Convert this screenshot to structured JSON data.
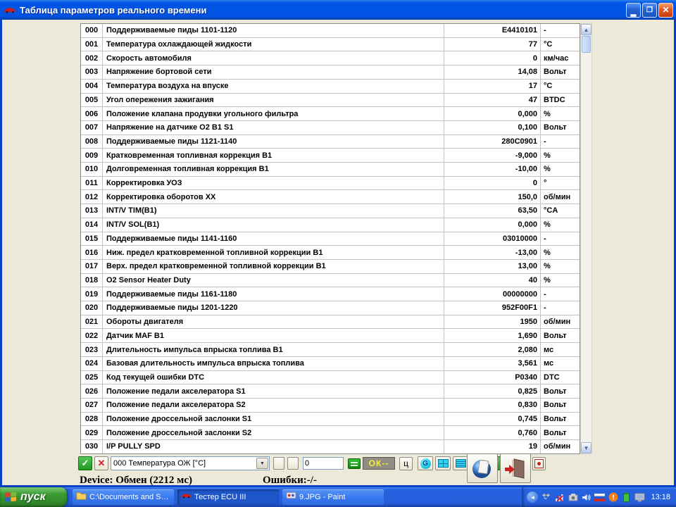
{
  "window": {
    "title": "Таблица параметров реального времени"
  },
  "icons": {
    "minimize": "▂",
    "restore": "❐",
    "close": "✕",
    "check": "✓",
    "cross": "✕",
    "arrow_up": "▲",
    "arrow_down": "▼",
    "chevron_left": "◄"
  },
  "table": {
    "rows": [
      {
        "id": "000",
        "name": "Поддерживаемые пиды 1101-1120",
        "value": "E4410101",
        "unit": "-"
      },
      {
        "id": "001",
        "name": "Температура охлаждающей жидкости",
        "value": "77",
        "unit": "°C"
      },
      {
        "id": "002",
        "name": "Скорость автомобиля",
        "value": "0",
        "unit": "км/час"
      },
      {
        "id": "003",
        "name": "Напряжение бортовой сети",
        "value": "14,08",
        "unit": "Вольт"
      },
      {
        "id": "004",
        "name": "Температура воздуха на впуске",
        "value": "17",
        "unit": "°C"
      },
      {
        "id": "005",
        "name": "Угол опережения зажигания",
        "value": "47",
        "unit": "BTDC"
      },
      {
        "id": "006",
        "name": "Положение клапана продувки угольного фильтра",
        "value": "0,000",
        "unit": "%"
      },
      {
        "id": "007",
        "name": "Напряжение на датчике O2 B1 S1",
        "value": "0,100",
        "unit": "Вольт"
      },
      {
        "id": "008",
        "name": "Поддерживаемые пиды 1121-1140",
        "value": "280C0901",
        "unit": "-"
      },
      {
        "id": "009",
        "name": "Кратковременная топливная коррекция B1",
        "value": "-9,000",
        "unit": "%"
      },
      {
        "id": "010",
        "name": "Долговременная топливная коррекция B1",
        "value": "-10,00",
        "unit": "%"
      },
      {
        "id": "011",
        "name": "Корректировка УОЗ",
        "value": "0",
        "unit": "°"
      },
      {
        "id": "012",
        "name": "Корректировка оборотов ХХ",
        "value": "150,0",
        "unit": "об/мин"
      },
      {
        "id": "013",
        "name": "INT/V TIM(B1)",
        "value": "63,50",
        "unit": "°CA"
      },
      {
        "id": "014",
        "name": "INT/V SOL(B1)",
        "value": "0,000",
        "unit": "%"
      },
      {
        "id": "015",
        "name": "Поддерживаемые пиды 1141-1160",
        "value": "03010000",
        "unit": "-"
      },
      {
        "id": "016",
        "name": "Ниж. предел кратковременной топливной коррекции B1",
        "value": "-13,00",
        "unit": "%"
      },
      {
        "id": "017",
        "name": "Верх. предел кратковременной топливной коррекции B1",
        "value": "13,00",
        "unit": "%"
      },
      {
        "id": "018",
        "name": "O2 Sensor Heater Duty",
        "value": "40",
        "unit": "%"
      },
      {
        "id": "019",
        "name": "Поддерживаемые пиды 1161-1180",
        "value": "00000000",
        "unit": "-"
      },
      {
        "id": "020",
        "name": "Поддерживаемые пиды 1201-1220",
        "value": "952F00F1",
        "unit": "-"
      },
      {
        "id": "021",
        "name": "Обороты двигателя",
        "value": "1950",
        "unit": "об/мин"
      },
      {
        "id": "022",
        "name": "Датчик MAF B1",
        "value": "1,690",
        "unit": "Вольт"
      },
      {
        "id": "023",
        "name": "Длительность импульса впрыска топлива B1",
        "value": "2,080",
        "unit": "мс"
      },
      {
        "id": "024",
        "name": "Базовая длительность импульса впрыска топлива",
        "value": "3,561",
        "unit": "мс"
      },
      {
        "id": "025",
        "name": "Код текущей ошибки DTC",
        "value": "P0340",
        "unit": "DTC"
      },
      {
        "id": "026",
        "name": "Положение педали акселератора S1",
        "value": "0,825",
        "unit": "Вольт"
      },
      {
        "id": "027",
        "name": "Положение педали акселератора S2",
        "value": "0,830",
        "unit": "Вольт"
      },
      {
        "id": "028",
        "name": "Положение дроссельной заслонки S1",
        "value": "0,745",
        "unit": "Вольт"
      },
      {
        "id": "029",
        "name": "Положение дроссельной заслонки S2",
        "value": "0,760",
        "unit": "Вольт"
      },
      {
        "id": "030",
        "name": "I/P PULLY SPD",
        "value": "19",
        "unit": "об/мин"
      }
    ]
  },
  "toolbar": {
    "combo_value": "000 Температура ОЖ [°C]",
    "input_value": "0",
    "ok_display": "ОК--",
    "c_button_label": "ц",
    "g_button_label": "G"
  },
  "status": {
    "device": "Device: Обмен (2212 мс)",
    "errors": "Ошибки:-/-"
  },
  "taskbar": {
    "start_label": "пуск",
    "clock": "13:18",
    "tasks": [
      {
        "label": "C:\\Documents and Se...",
        "icon": "folder",
        "active": false
      },
      {
        "label": "Тестер ECU III",
        "icon": "car",
        "active": true
      },
      {
        "label": "9.JPG - Paint",
        "icon": "paint",
        "active": false
      }
    ]
  },
  "colors": {
    "titlebar_blue": "#0054e3",
    "taskbar_blue": "#245edb",
    "client_beige": "#ece9d8",
    "accent_green": "#1f9a1f",
    "accent_red": "#d42020",
    "toolbar_cyan": "#35d0ee",
    "ok_yellow": "#f8f02a"
  }
}
